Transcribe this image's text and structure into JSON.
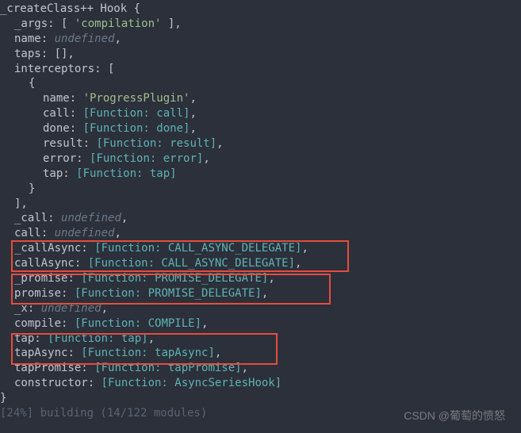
{
  "header": "_createClass++ Hook {",
  "args_label": "_args",
  "args_value": "'compilation'",
  "name_label": "name",
  "undefined": "undefined",
  "taps_label": "taps",
  "interceptors_label": "interceptors",
  "interceptor": {
    "name_label": "name",
    "name_value": "'ProgressPlugin'",
    "call_label": "call",
    "call_value": "[Function: call]",
    "done_label": "done",
    "done_value": "[Function: done]",
    "result_label": "result",
    "result_value": "[Function: result]",
    "error_label": "error",
    "error_value": "[Function: error]",
    "tap_label": "tap",
    "tap_value": "[Function: tap]"
  },
  "_call_label": "_call",
  "call_label": "call",
  "_callAsync_label": "_callAsync",
  "_callAsync_value": "[Function: CALL_ASYNC_DELEGATE]",
  "callAsync_label": "callAsync",
  "callAsync_value": "[Function: CALL_ASYNC_DELEGATE]",
  "_promise_label": "_promise",
  "_promise_value": "[Function: PROMISE_DELEGATE]",
  "promise_label": "promise",
  "promise_value": "[Function: PROMISE_DELEGATE]",
  "_x_label": "_x",
  "compile_label": "compile",
  "compile_value": "[Function: COMPILE]",
  "tap_label": "tap",
  "tap_value": "[Function: tap]",
  "tapAsync_label": "tapAsync",
  "tapAsync_value": "[Function: tapAsync]",
  "tapPromise_label": "tapPromise",
  "tapPromise_value": "[Function: tapPromise]",
  "constructor_label": "constructor",
  "constructor_value": "[Function: AsyncSeriesHook]",
  "footer_faded": "[24%] building (14/122 modules)",
  "watermark": "CSDN @葡萄的愤怒"
}
